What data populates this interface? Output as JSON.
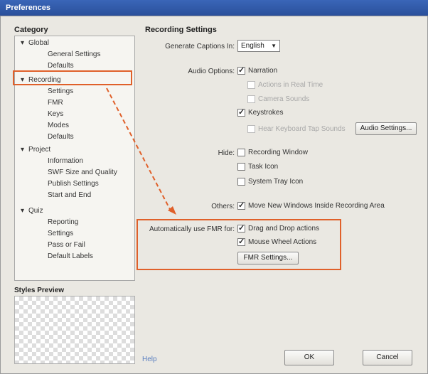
{
  "window": {
    "title": "Preferences"
  },
  "category": {
    "title": "Category",
    "items": [
      {
        "label": "Global",
        "group": true
      },
      {
        "label": "General Settings",
        "group": false
      },
      {
        "label": "Defaults",
        "group": false
      },
      {
        "label": "Recording",
        "group": true
      },
      {
        "label": "Settings",
        "group": false
      },
      {
        "label": "FMR",
        "group": false
      },
      {
        "label": "Keys",
        "group": false
      },
      {
        "label": "Modes",
        "group": false
      },
      {
        "label": "Defaults",
        "group": false
      },
      {
        "label": "Project",
        "group": true
      },
      {
        "label": "Information",
        "group": false
      },
      {
        "label": "SWF Size and Quality",
        "group": false
      },
      {
        "label": "Publish Settings",
        "group": false
      },
      {
        "label": "Start and End",
        "group": false
      },
      {
        "label": "Quiz",
        "group": true
      },
      {
        "label": "Reporting",
        "group": false
      },
      {
        "label": "Settings",
        "group": false
      },
      {
        "label": "Pass or Fail",
        "group": false
      },
      {
        "label": "Default Labels",
        "group": false
      }
    ],
    "style_preview_label": "Styles Preview"
  },
  "recording": {
    "title": "Recording Settings",
    "captions_label": "Generate Captions In:",
    "captions_value": "English",
    "audio_label": "Audio Options:",
    "narration": "Narration",
    "actions_in_real_time": "Actions in Real Time",
    "camera_sounds": "Camera Sounds",
    "keystrokes": "Keystrokes",
    "hear_keyboard_tap": "Hear Keyboard Tap Sounds",
    "audio_settings_button": "Audio Settings...",
    "hide_label": "Hide:",
    "hide_recording_window": "Recording Window",
    "hide_task_icon": "Task Icon",
    "hide_system_tray": "System Tray Icon",
    "others_label": "Others:",
    "move_new_windows": "Move New Windows Inside Recording Area",
    "fmr_label": "Automatically use FMR for:",
    "drag_drop": "Drag and Drop actions",
    "mouse_wheel": "Mouse Wheel Actions",
    "fmr_settings_button": "FMR Settings..."
  },
  "footer": {
    "help": "Help",
    "ok": "OK",
    "cancel": "Cancel"
  },
  "colors": {
    "highlight": "#e0602a",
    "title_bar": "#2a4f9a"
  }
}
